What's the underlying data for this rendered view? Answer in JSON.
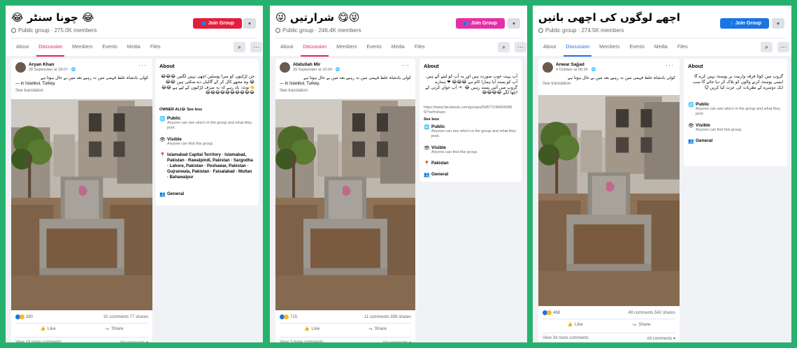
{
  "panels": [
    {
      "title": "😂 چونا سنٹر 😂",
      "meta": "Public group · 275.0K members",
      "join_label": "Join Group",
      "join_color": "#e41e3f",
      "tabs": [
        "About",
        "Discussion",
        "Members",
        "Events",
        "Media",
        "Files"
      ],
      "active_tab": "Discussion",
      "post": {
        "author": "Aryan Khan",
        "date": "28 September at 18:07 · 🌐",
        "text": "کولی بادشاہ غلط فہمی میں نہ رہیے بعد میں بے حال ہوتا ہے",
        "location": "— in Istanbul, Turkey.",
        "translation": "See translation",
        "reactions": "380",
        "comments_shares": "31 comments  77 shares",
        "like": "Like",
        "share": "Share",
        "more_comments": "View 19 more comments",
        "all_comments": "All comments ▾"
      },
      "about": {
        "heading": "About",
        "desc": "جن لڑکیوں کو میرا پوسٹیں اچھی نہیں لگتیں 😂😂😂😂 وہ مجھے کال کر کے گالیاں دے سکتی ہیں 😂😂 👈نوٹ: یاد رہے کہ یہ صرف لڑکیوں کے لیے ہے 😂😂😂😂😂😂😂😂😂😂😂😂",
        "owner_note": "OWNER ALI😂 See less",
        "public_title": "Public",
        "public_sub": "Anyone can see who's in the group and what they post.",
        "visible_title": "Visible",
        "visible_sub": "Anyone can find this group.",
        "location": "Islamabad Capital Territory · Islamabad, Pakistan · Rawalpindi, Pakistan · Sargodha · Lahore, Pakistan · Peshawar, Pakistan · Gujranwala, Pakistan · Faisalabad · Multan · Bahawalpur",
        "general": "General"
      }
    },
    {
      "title": "😜😋 شرارتیں 😜",
      "meta": "Public group · 246.4K members",
      "join_label": "Join Group",
      "join_color": "#e62fa6",
      "tabs": [
        "About",
        "Discussion",
        "Members",
        "Events",
        "Media",
        "Files"
      ],
      "active_tab": "Discussion",
      "post": {
        "author": "Abdullah Mir",
        "date": "29 September at 10:04 · 🌐",
        "text": "کولی بادشاہ غلط فہمی میں نہ رہیے بعد میں بے حال ہوتا ہے",
        "location": "— in Istanbul, Turkey.",
        "translation": "See translation",
        "reactions": "715",
        "comments_shares": "11 comments  399 shares",
        "like": "Like",
        "share": "Share",
        "more_comments": "View 3 more comments",
        "all_comments": "All comments ▾"
      },
      "about": {
        "heading": "About",
        "desc": "آپ بہت خوب صورت ہیں اور یہ آپ کو لیتے آئے ہیں آپ کو پسند آیا ہمارا کام ہے 😂😂😂 ❤ ہمارے گروپ میں آئیں پسند رہیں 😂 💌 آپ جوان کرتی کے اچھا لگے 😂😂😂😂",
        "link": "https://www.facebook.com/groups/508772496943869/?ref=share",
        "see_less": "See less",
        "public_title": "Public",
        "public_sub": "Anyone can see who's in the group and what they post.",
        "visible_title": "Visible",
        "visible_sub": "Anyone can find this group.",
        "location": "Pakistan",
        "general": "General"
      }
    },
    {
      "title": "اچھے لوگوں کی اچھی باتیں",
      "meta": "Public group · 274.5K members",
      "join_label": "Join Group",
      "join_color": "#1b74e4",
      "tabs": [
        "About",
        "Discussion",
        "Members",
        "Events",
        "Media",
        "Files"
      ],
      "active_tab": "Discussion",
      "post": {
        "author": "Anwar Sajjad",
        "date": "4 October at 06:34 · 🌐",
        "text": "کولی بادشاہ غلط فہمی میں نہ رہیے بعد میں بے حال ہوتا ہے",
        "translation": "See translation",
        "reactions": "468",
        "comments_shares": "49 comments  542 shares",
        "like": "Like",
        "share": "Share",
        "more_comments": "View 34 more comments",
        "all_comments": "All comments ▾"
      },
      "about": {
        "heading": "About",
        "desc": "گروپ میں کوئا فرقہ وارنیت پر پوسٹ نہیں کرے گا ایسی پوسٹ کرنے والوں کو بلاک کر دیا جائے گا سب ایک دوسرے کے نظریات کی عزت کیا کریں 😊",
        "public_title": "Public",
        "public_sub": "Anyone can see who's in the group and what they post.",
        "visible_title": "Visible",
        "visible_sub": "Anyone can find this group.",
        "general": "General"
      }
    }
  ],
  "colors": {
    "active_tab": "#e0245e",
    "active_tab_blue": "#1b74e4",
    "link": "#1b74e4",
    "background": "#27b16e"
  }
}
